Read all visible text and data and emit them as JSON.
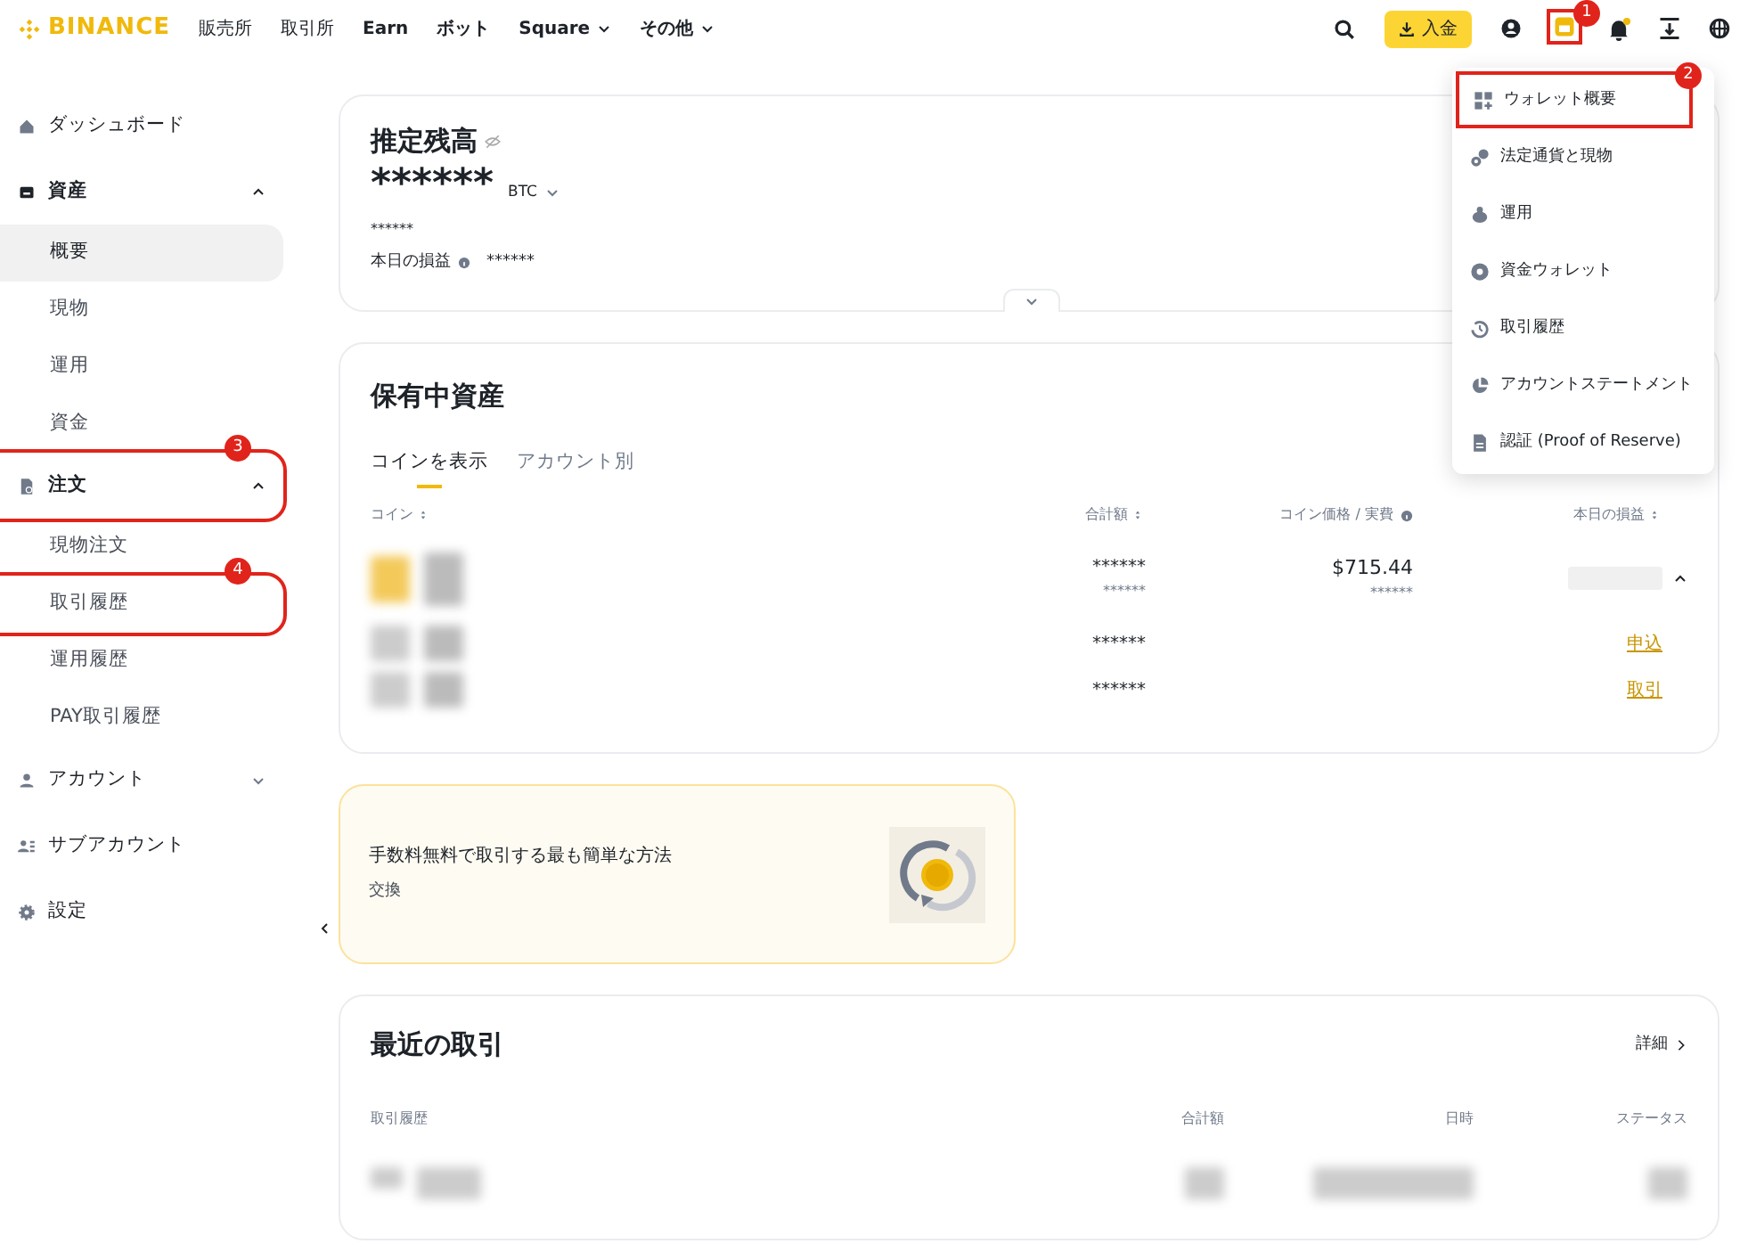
{
  "header": {
    "logo": "BINANCE",
    "nav": [
      {
        "label": "販売所",
        "caret": false
      },
      {
        "label": "取引所",
        "caret": false
      },
      {
        "label": "Earn",
        "caret": false
      },
      {
        "label": "ボット",
        "caret": false
      },
      {
        "label": "Square",
        "caret": true
      },
      {
        "label": "その他",
        "caret": true
      }
    ],
    "deposit": "入金",
    "wallet_callout": "1",
    "unread": true
  },
  "sidebar": {
    "items": [
      {
        "label": "ダッシュボード",
        "selected": false
      },
      {
        "label": "資産",
        "selected": false,
        "expanded": true,
        "children": [
          {
            "label": "概要",
            "selected": true
          },
          {
            "label": "現物",
            "selected": false
          },
          {
            "label": "運用",
            "selected": false
          },
          {
            "label": "資金",
            "selected": false
          }
        ]
      },
      {
        "label": "注文",
        "selected": false,
        "expanded": true,
        "callout": "3",
        "children": [
          {
            "label": "現物注文",
            "selected": false
          },
          {
            "label": "取引履歴",
            "selected": false,
            "callout": "4"
          },
          {
            "label": "運用履歴",
            "selected": false
          },
          {
            "label": "PAY取引履歴",
            "selected": false
          }
        ]
      },
      {
        "label": "アカウント",
        "selected": false,
        "expanded": false
      },
      {
        "label": "サブアカウント",
        "selected": false
      },
      {
        "label": "設定",
        "selected": false
      }
    ]
  },
  "balance": {
    "title": "推定残高",
    "value": "******",
    "unit": "BTC",
    "sub": "******",
    "pnl_label": "本日の損益",
    "pnl_value": "******"
  },
  "holdings": {
    "title": "保有中資産",
    "tabs": [
      {
        "label": "コインを表示",
        "selected": true
      },
      {
        "label": "アカウント別",
        "selected": false
      }
    ],
    "columns": [
      "コイン",
      "合計額",
      "コイン価格 / 実費",
      "本日の損益"
    ],
    "rows": [
      {
        "total": "******",
        "total_sub": "******",
        "price": "$715.44",
        "price_sub": "******",
        "expanded": true
      },
      {
        "total": "******",
        "action": "申込"
      },
      {
        "total": "******",
        "action": "取引"
      }
    ]
  },
  "promo": {
    "text": "手数料無料で取引する最も簡単な方法",
    "sub": "交換"
  },
  "recent": {
    "title": "最近の取引",
    "link": "詳細",
    "columns": [
      "取引履歴",
      "合計額",
      "日時",
      "ステータス"
    ]
  },
  "wallet_menu": {
    "items": [
      {
        "label": "ウォレット概要",
        "callout": "2"
      },
      {
        "label": "法定通貨と現物"
      },
      {
        "label": "運用"
      },
      {
        "label": "資金ウォレット"
      },
      {
        "label": "取引履歴"
      },
      {
        "label": "アカウントステートメント"
      },
      {
        "label": "認証 (Proof of Reserve)"
      }
    ]
  }
}
